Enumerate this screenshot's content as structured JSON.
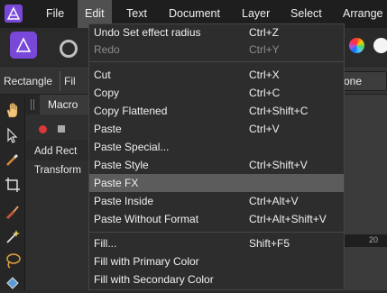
{
  "menubar": {
    "items": [
      "File",
      "Edit",
      "Text",
      "Document",
      "Layer",
      "Select",
      "Arrange"
    ]
  },
  "context_bar": {
    "tool_name": "Rectangle",
    "fill_fragment": "Fil",
    "none_fragment": "one"
  },
  "panel": {
    "tab_fragment": "Macro",
    "row1_fragment": "Add Rect",
    "row2_fragment": "Transform"
  },
  "ruler": {
    "label_fragment": "20"
  },
  "edit_menu": {
    "items": [
      {
        "label": "Undo Set effect radius",
        "shortcut": "Ctrl+Z"
      },
      {
        "label": "Redo",
        "shortcut": "Ctrl+Y",
        "disabled": true
      },
      {
        "label": "Cut",
        "shortcut": "Ctrl+X"
      },
      {
        "label": "Copy",
        "shortcut": "Ctrl+C"
      },
      {
        "label": "Copy Flattened",
        "shortcut": "Ctrl+Shift+C"
      },
      {
        "label": "Paste",
        "shortcut": "Ctrl+V"
      },
      {
        "label": "Paste Special...",
        "shortcut": ""
      },
      {
        "label": "Paste Style",
        "shortcut": "Ctrl+Shift+V"
      },
      {
        "label": "Paste FX",
        "shortcut": "",
        "highlighted": true
      },
      {
        "label": "Paste Inside",
        "shortcut": "Ctrl+Alt+V"
      },
      {
        "label": "Paste Without Format",
        "shortcut": "Ctrl+Alt+Shift+V"
      },
      {
        "label": "Fill...",
        "shortcut": "Shift+F5"
      },
      {
        "label": "Fill with Primary Color",
        "shortcut": ""
      },
      {
        "label": "Fill with Secondary Color",
        "shortcut": ""
      }
    ]
  },
  "colors": {
    "accent_persona": "#7a48d8",
    "menu_highlight": "#5c5c5c",
    "record": "#d83a3a"
  },
  "icons": [
    "affinity-designer-logo",
    "designer-persona-icon",
    "pixel-persona-icon",
    "color-wheel-icon",
    "hand-tool-icon",
    "move-tool-icon",
    "eyedropper-icon",
    "crop-icon",
    "brush-icon",
    "magic-wand-icon",
    "lasso-icon",
    "fill-bucket-icon"
  ]
}
